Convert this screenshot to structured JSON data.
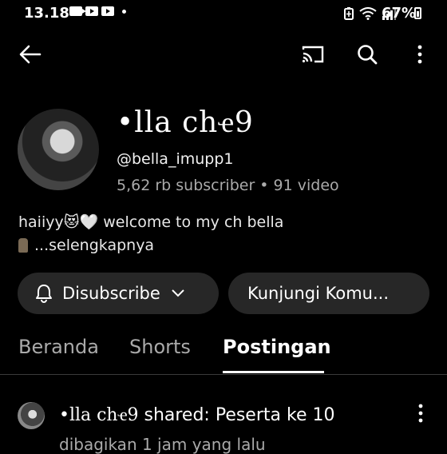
{
  "status_bar": {
    "time": "13.18",
    "battery": "67%",
    "icons": [
      "video-camera-icon",
      "youtube-icon",
      "youtube-icon",
      "notification-dot",
      "battery-saver-icon",
      "wifi-icon",
      "signal-icon"
    ]
  },
  "top_bar": {
    "icons": [
      "back-arrow-icon",
      "cast-icon",
      "search-icon",
      "more-vert-icon"
    ]
  },
  "channel": {
    "name": "•lla cհҽ9",
    "handle": "@bella_imupp1",
    "stats": "5,62 rb subscriber • 91 video",
    "description_line1": "haiiyy😻🤍 welcome to my ch bella",
    "description_line2": "...selengkapnya"
  },
  "actions": {
    "subscribe_label": "Disubscribe",
    "community_label": "Kunjungi Komu..."
  },
  "tabs": [
    {
      "label": "Beranda",
      "selected": false
    },
    {
      "label": "Shorts",
      "selected": false
    },
    {
      "label": "Postingan",
      "selected": true
    }
  ],
  "post": {
    "author": "•lla cհҽ9",
    "title_suffix": " shared: Peserta ke 10",
    "meta": "dibagikan 1 jam yang lalu"
  },
  "colors": {
    "background": "#000000",
    "pill": "#272727",
    "secondary_text": "#aaaaaa"
  }
}
